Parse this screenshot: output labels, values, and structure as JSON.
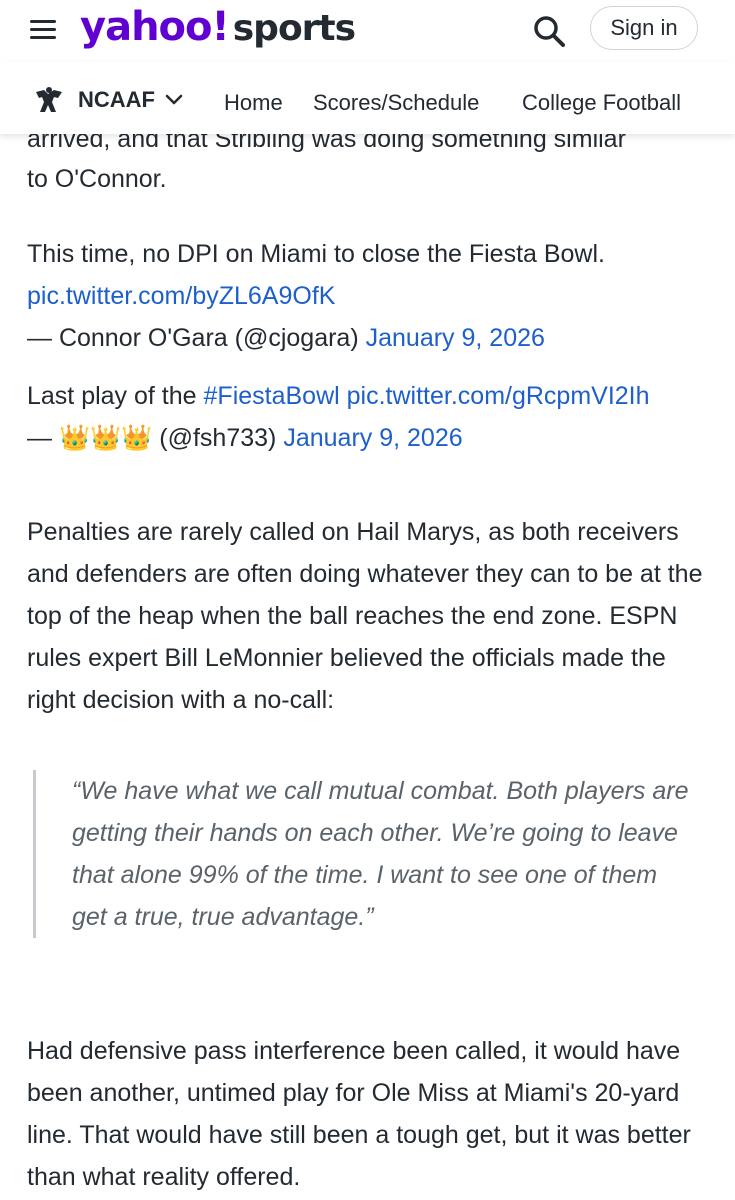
{
  "header": {
    "brand": "yahoo!",
    "brand_suffix": "sports",
    "signin_label": "Sign in"
  },
  "subnav": {
    "section": "NCAAF",
    "links": [
      "Home",
      "Scores/Schedule",
      "College Football"
    ]
  },
  "article": {
    "cut_line": "arrived, and that Stribling was doing something similar",
    "line_to_oconnor": "to O'Connor.",
    "tweet1_text": "This time, no DPI on Miami to close the Fiesta Bowl.",
    "tweet1_link": "pic.twitter.com/byZL6A9OfK",
    "tweet1_author": "— Connor O'Gara (@cjogara)",
    "tweet1_date": "January 9, 2026",
    "tweet2_text": "Last play of the",
    "tweet2_hashtag": "#FiestaBowl",
    "tweet2_link": "pic.twitter.com/gRcpmVI2Ih",
    "tweet2_author": "— 👑👑👑 (@fsh733)",
    "tweet2_date": "January 9, 2026",
    "para1": "Penalties are rarely called on Hail Marys, as both receivers and defenders are often doing whatever they can to be at the top of the heap when the ball reaches the end zone. ESPN rules expert Bill LeMonnier believed the officials made the right decision with a no-call:",
    "quote": "“We have what we call mutual combat. Both players are getting their hands on each other. We’re going to leave that alone 99% of the time. I want to see one of them get a true, true advantage.”",
    "para2": "Had defensive pass interference been called, it would have been another, untimed play for Ole Miss at Miami's 20-yard line. That would have still been a tough get, but it was better than what reality offered."
  },
  "colors": {
    "brand_purple": "#6001d2",
    "link_blue": "#1d5fcb",
    "text": "#232a31"
  }
}
